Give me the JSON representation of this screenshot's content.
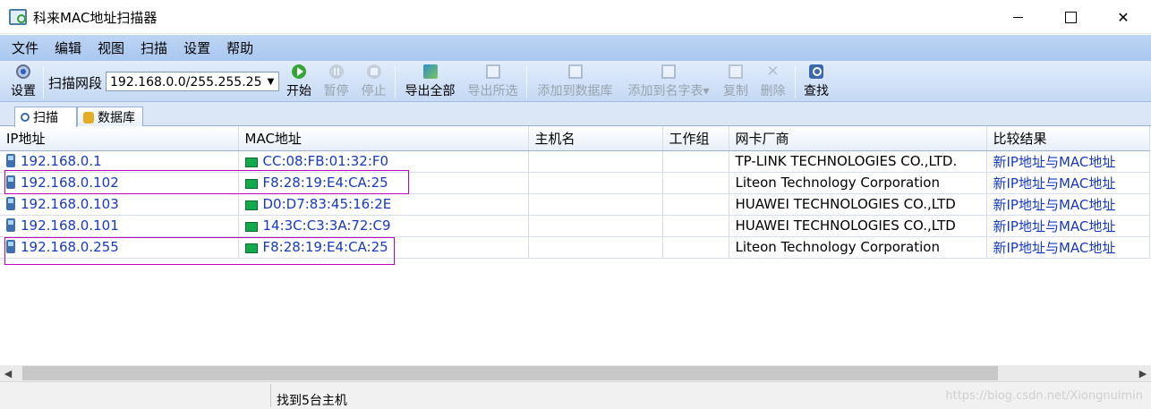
{
  "window": {
    "title": "科来MAC地址扫描器",
    "close_symbol": "✕"
  },
  "menu": [
    "文件",
    "编辑",
    "视图",
    "扫描",
    "设置",
    "帮助"
  ],
  "toolbar": {
    "settings": "设置",
    "scan_range_label": "扫描网段",
    "scan_range_value": "192.168.0.0/255.255.25",
    "dropdown_symbol": "▼",
    "buttons": {
      "start": "开始",
      "pause": "暂停",
      "stop": "停止",
      "export_all": "导出全部",
      "export_selected": "导出所选",
      "add_to_database": "添加到数据库",
      "add_to_name_table": "添加到名字表",
      "copy": "复制",
      "delete": "删除",
      "find": "查找"
    },
    "name_table_arrow": "▾",
    "delete_symbol": "✕"
  },
  "tabs": [
    {
      "label": "扫描"
    },
    {
      "label": "数据库"
    }
  ],
  "table": {
    "columns": [
      "IP地址",
      "MAC地址",
      "主机名",
      "工作组",
      "网卡厂商",
      "比较结果"
    ],
    "rows": [
      {
        "ip": "192.168.0.1",
        "mac": "CC:08:FB:01:32:F0",
        "host": "",
        "workgroup": "",
        "vendor": "TP-LINK TECHNOLOGIES CO.,LTD.",
        "result": "新IP地址与MAC地址"
      },
      {
        "ip": "192.168.0.102",
        "mac": "F8:28:19:E4:CA:25",
        "host": "",
        "workgroup": "",
        "vendor": "Liteon Technology Corporation",
        "result": "新IP地址与MAC地址"
      },
      {
        "ip": "192.168.0.103",
        "mac": "D0:D7:83:45:16:2E",
        "host": "",
        "workgroup": "",
        "vendor": "HUAWEI TECHNOLOGIES CO.,LTD",
        "result": "新IP地址与MAC地址"
      },
      {
        "ip": "192.168.0.101",
        "mac": "14:3C:C3:3A:72:C9",
        "host": "",
        "workgroup": "",
        "vendor": "HUAWEI TECHNOLOGIES CO.,LTD",
        "result": "新IP地址与MAC地址"
      },
      {
        "ip": "192.168.0.255",
        "mac": "F8:28:19:E4:CA:25",
        "host": "",
        "workgroup": "",
        "vendor": "Liteon Technology Corporation",
        "result": "新IP地址与MAC地址"
      }
    ]
  },
  "scrollbar": {
    "left_arrow": "◀",
    "right_arrow": "▶"
  },
  "status": {
    "message": "找到5台主机",
    "watermark": "https://blog.csdn.net/Xiongnuimin"
  },
  "colors": {
    "title_bar": "#ffffff",
    "menu_bar": "#b4ceef",
    "toolbar": "#d6e5f8",
    "link_text": "#1638c8",
    "highlight_border": "#c000c0"
  }
}
